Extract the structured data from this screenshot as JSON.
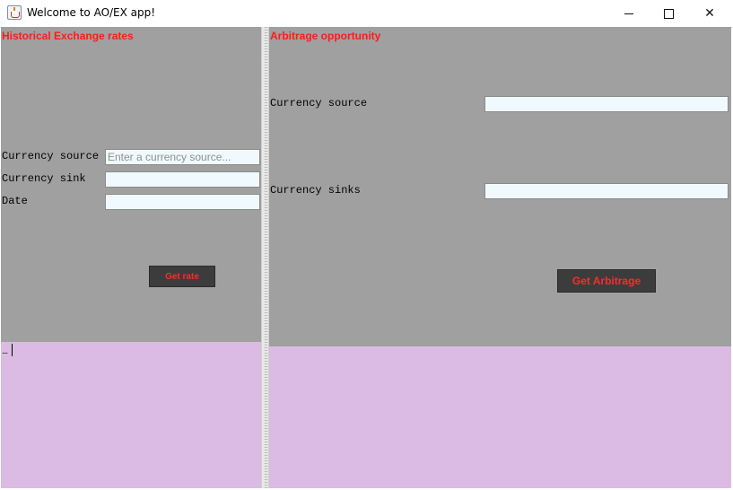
{
  "window": {
    "title": "Welcome to AO/EX app!",
    "controls": {
      "minimize": "—",
      "maximize": "☐",
      "close": "✕"
    }
  },
  "historical": {
    "title": "Historical Exchange rates",
    "source_label": "Currency source",
    "source_placeholder": "Enter a currency source...",
    "source_value": "",
    "sink_label": "Currency sink",
    "sink_value": "",
    "date_label": "Date",
    "date_value": "",
    "button_label": "Get rate",
    "output_text": "...."
  },
  "arbitrage": {
    "title": "Arbitrage opportunity",
    "source_label": "Currency source",
    "source_value": "",
    "sinks_label": "Currency sinks",
    "sinks_value": "",
    "button_label": "Get Arbitrage",
    "output_text": ""
  },
  "colors": {
    "panel_gray": "#a0a0a0",
    "output_lilac": "#dbbbe3",
    "accent_red": "#ff1a1a",
    "button_dark": "#3c3c3c",
    "field_bg": "#f0fafe"
  },
  "icons": {
    "app": "java-cup-icon",
    "minimize": "minimize-icon",
    "maximize": "maximize-icon",
    "close": "close-icon"
  }
}
